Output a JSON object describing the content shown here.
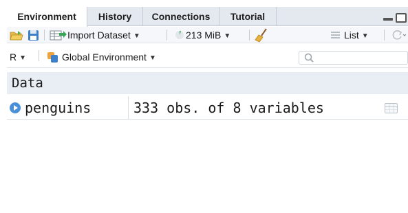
{
  "tabs": [
    {
      "label": "Environment",
      "active": true
    },
    {
      "label": "History",
      "active": false
    },
    {
      "label": "Connections",
      "active": false
    },
    {
      "label": "Tutorial",
      "active": false
    }
  ],
  "toolbar": {
    "import_label": "Import Dataset",
    "memory_label": "213 MiB",
    "view_mode_label": "List",
    "icons": [
      "open-folder-icon",
      "save-icon",
      "import-dataset-icon",
      "memory-pie-icon",
      "broom-icon",
      "list-icon",
      "refresh-icon"
    ]
  },
  "env": {
    "language": "R",
    "scope": "Global Environment",
    "search_placeholder": ""
  },
  "data_section": {
    "header": "Data",
    "rows": [
      {
        "name": "penguins",
        "value": "333 obs. of 8 variables"
      }
    ]
  },
  "colors": {
    "tab_bar_bg": "#e4e9f0",
    "header_bg": "#e9eef4",
    "accent": "#4a90d9"
  }
}
